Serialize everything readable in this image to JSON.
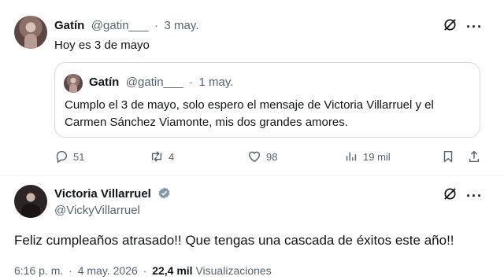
{
  "reply_tweet": {
    "author_name": "Gatín",
    "handle": "@gatin___",
    "separator": "·",
    "date": "3 may.",
    "text": "Hoy es 3 de mayo",
    "avatar_icon": "user-avatar-photo"
  },
  "quoted_tweet": {
    "author_name": "Gatín",
    "handle": "@gatin___",
    "separator": "·",
    "date": "1 may.",
    "text_line1": "Cumplo el 3 de mayo, solo espero el mensaje de Victoria Villarruel y el",
    "text_line2": "Carmen Sánchez Viamonte, mis dos  grandes amores."
  },
  "actions": {
    "replies": "51",
    "reposts": "4",
    "likes": "98",
    "views": "19 mil"
  },
  "main_tweet": {
    "author_name": "Victoria Villarruel",
    "handle": "@VickyVillarruel",
    "text": "Feliz cumpleaños atrasado!! Que tengas una cascada de éxitos este año!!",
    "time": "6:16 p. m.",
    "separator": "·",
    "date": "4 may. 2026",
    "separator2": "·",
    "views_count": "22,4 mil",
    "views_label": "Visualizaciones"
  },
  "colors": {
    "text_primary": "#0f1419",
    "text_secondary": "#536471",
    "border": "#cfd9de",
    "verified": "#829aab"
  }
}
